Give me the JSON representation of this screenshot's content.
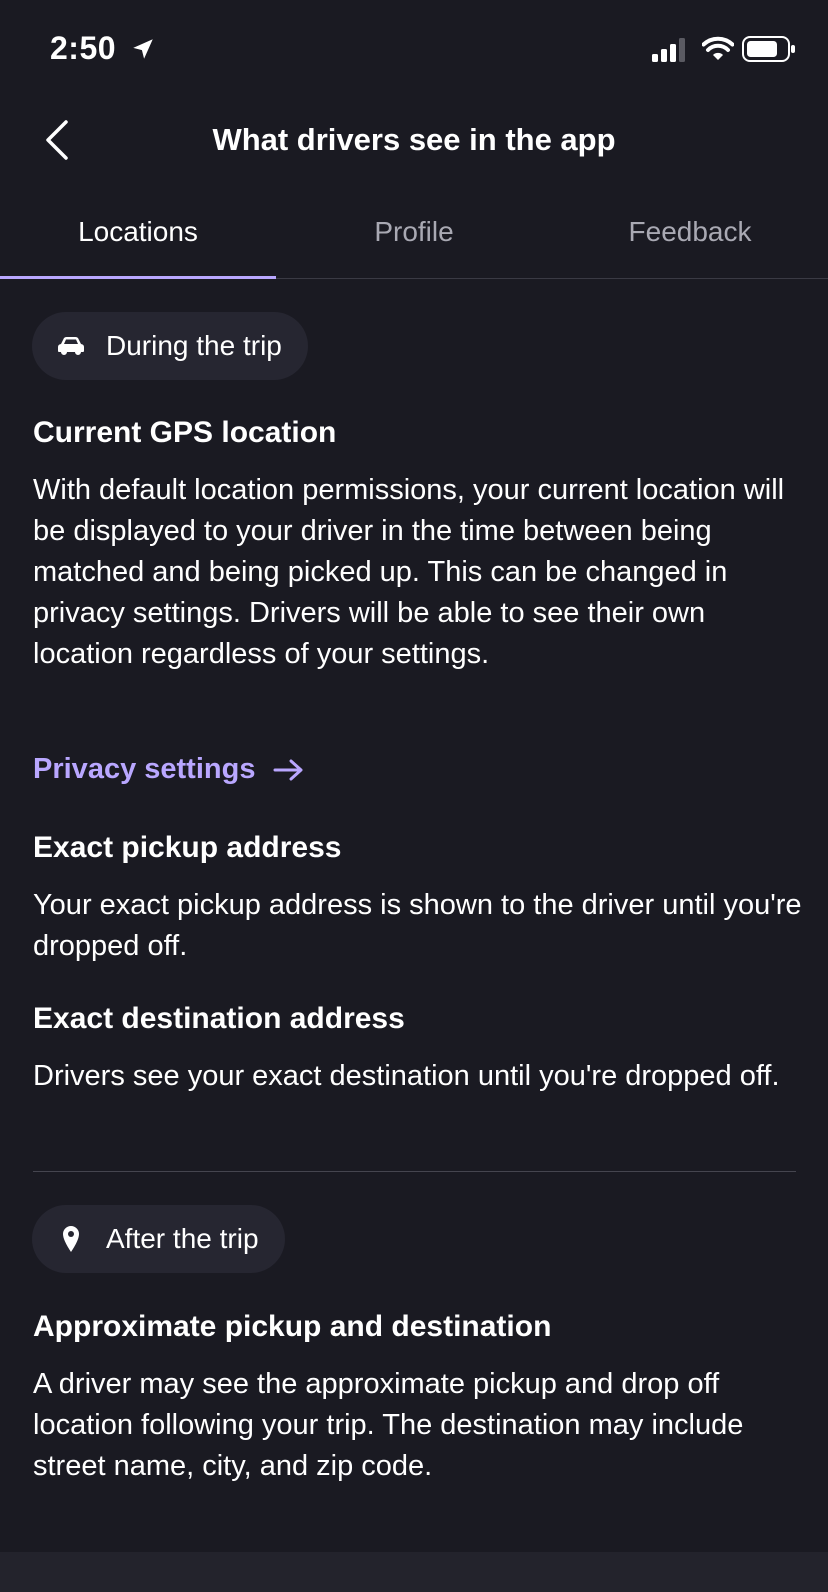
{
  "status_bar": {
    "time": "2:50"
  },
  "header": {
    "title": "What drivers see in the app"
  },
  "tabs": [
    {
      "label": "Locations",
      "active": true
    },
    {
      "label": "Profile",
      "active": false
    },
    {
      "label": "Feedback",
      "active": false
    }
  ],
  "during_trip": {
    "chip_label": "During the trip",
    "chip_icon": "car-icon",
    "gps": {
      "title": "Current GPS location",
      "body": "With default location permissions, your current location will be displayed to your driver in the time between being matched and being picked up. This can be changed in privacy settings. Drivers will be able to see their own location regardless of your settings."
    },
    "privacy_link": "Privacy settings",
    "pickup": {
      "title": "Exact pickup address",
      "body": "Your exact pickup address is shown to the driver until you're dropped off."
    },
    "destination": {
      "title": "Exact destination address",
      "body": "Drivers see your exact destination until you're dropped off."
    }
  },
  "after_trip": {
    "chip_label": "After the trip",
    "chip_icon": "map-pin-icon",
    "approx": {
      "title": "Approximate pickup and destination",
      "body": "A driver may see the approximate pickup and drop off location following your trip. The destination may include street name, city, and zip code."
    }
  },
  "colors": {
    "background": "#1a1a22",
    "accent": "#b9a7ff",
    "chip": "#262631"
  }
}
